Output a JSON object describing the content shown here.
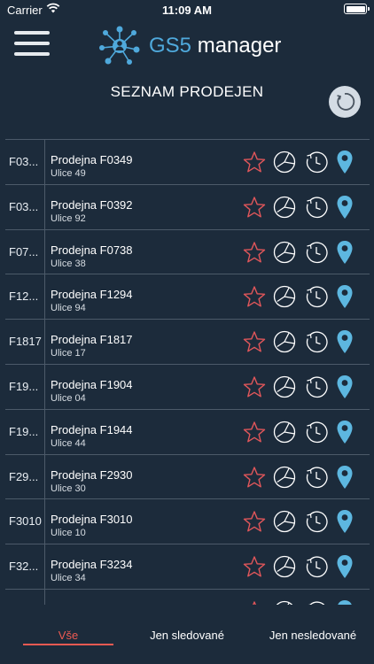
{
  "status_bar": {
    "carrier": "Carrier",
    "time": "11:09 AM",
    "icons": [
      "wifi-icon",
      "battery-icon"
    ]
  },
  "header": {
    "brand_prefix": "GS5",
    "brand_suffix": "manager",
    "logo_icon": "network-hub-icon",
    "menu_icon": "hamburger-menu-icon"
  },
  "page": {
    "title": "SEZNAM PRODEJEN",
    "refresh_icon": "refresh-icon"
  },
  "stores": [
    {
      "code": "F03...",
      "name": "Prodejna F0349",
      "street": "Ulice 49"
    },
    {
      "code": "F03...",
      "name": "Prodejna F0392",
      "street": "Ulice 92"
    },
    {
      "code": "F07...",
      "name": "Prodejna F0738",
      "street": "Ulice 38"
    },
    {
      "code": "F12...",
      "name": "Prodejna F1294",
      "street": "Ulice 94"
    },
    {
      "code": "F1817",
      "name": "Prodejna F1817",
      "street": "Ulice 17"
    },
    {
      "code": "F19...",
      "name": "Prodejna F1904",
      "street": "Ulice 04"
    },
    {
      "code": "F19...",
      "name": "Prodejna F1944",
      "street": "Ulice 44"
    },
    {
      "code": "F29...",
      "name": "Prodejna F2930",
      "street": "Ulice 30"
    },
    {
      "code": "F3010",
      "name": "Prodejna F3010",
      "street": "Ulice 10"
    },
    {
      "code": "F32...",
      "name": "Prodejna F3234",
      "street": "Ulice 34"
    },
    {
      "code": "",
      "name": "",
      "street": ""
    }
  ],
  "row_icons": [
    "star-icon",
    "pie-chart-icon",
    "history-icon",
    "map-pin-icon"
  ],
  "colors": {
    "background": "#1c2b3b",
    "accent_blue": "#4fa9dc",
    "star_red": "#e0565a",
    "active_tab": "#ee5a52",
    "divider": "#4c5a69"
  },
  "tabs": [
    {
      "label": "Vše",
      "active": true
    },
    {
      "label": "Jen sledované",
      "active": false
    },
    {
      "label": "Jen nesledované",
      "active": false
    }
  ]
}
